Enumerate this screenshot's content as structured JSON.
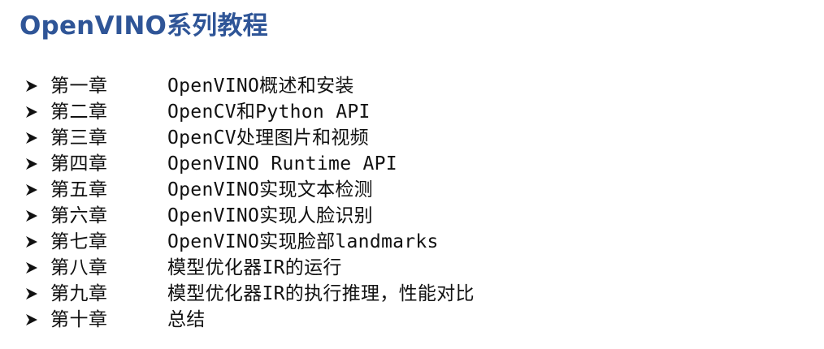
{
  "document": {
    "title": "OpenVINO系列教程",
    "accent_color": "#2f5597",
    "bullet_icon": "arrowhead-bullet-icon",
    "chapters": [
      {
        "chapter": "第一章",
        "title": "OpenVINO概述和安装"
      },
      {
        "chapter": "第二章",
        "title": "OpenCV和Python API"
      },
      {
        "chapter": "第三章",
        "title": "OpenCV处理图片和视频"
      },
      {
        "chapter": "第四章",
        "title": "OpenVINO Runtime API"
      },
      {
        "chapter": "第五章",
        "title": "OpenVINO实现文本检测"
      },
      {
        "chapter": "第六章",
        "title": "OpenVINO实现人脸识别"
      },
      {
        "chapter": "第七章",
        "title": "OpenVINO实现脸部landmarks"
      },
      {
        "chapter": "第八章",
        "title": "模型优化器IR的运行"
      },
      {
        "chapter": "第九章",
        "title": "模型优化器IR的执行推理，性能对比"
      },
      {
        "chapter": "第十章",
        "title": "总结"
      }
    ]
  }
}
